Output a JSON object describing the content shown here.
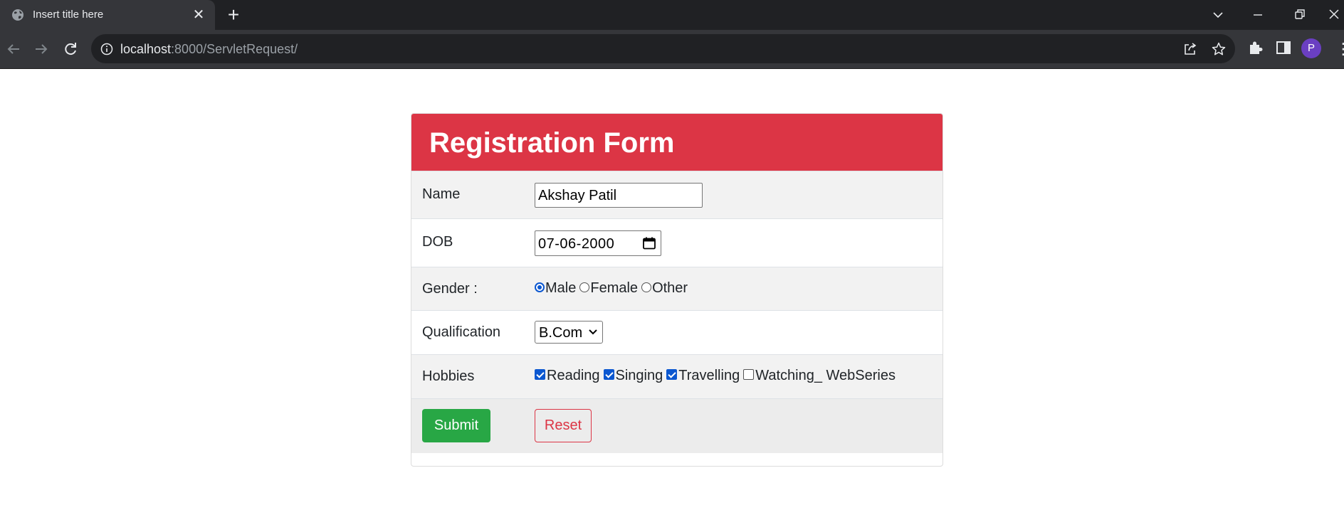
{
  "browser": {
    "tab_title": "Insert title here",
    "url_host": "localhost",
    "url_path": ":8000/ServletRequest/",
    "profile_initial": "P"
  },
  "form": {
    "title": "Registration Form",
    "name": {
      "label": "Name",
      "value": "Akshay Patil"
    },
    "dob": {
      "label": "DOB",
      "value": "07-06-2000"
    },
    "gender": {
      "label": "Gender :",
      "options": [
        {
          "label": "Male",
          "checked": true
        },
        {
          "label": "Female",
          "checked": false
        },
        {
          "label": "Other",
          "checked": false
        }
      ]
    },
    "qualification": {
      "label": "Qualification",
      "selected": "B.Com"
    },
    "hobbies": {
      "label": "Hobbies",
      "options": [
        {
          "label": "Reading",
          "checked": true
        },
        {
          "label": "Singing",
          "checked": true
        },
        {
          "label": "Travelling",
          "checked": true
        },
        {
          "label": "Watching_ WebSeries",
          "checked": false
        }
      ]
    },
    "submit_label": "Submit",
    "reset_label": "Reset"
  },
  "colors": {
    "header": "#dc3545",
    "submit": "#28a745",
    "reset": "#dc3545",
    "checked": "#0b57d0"
  }
}
